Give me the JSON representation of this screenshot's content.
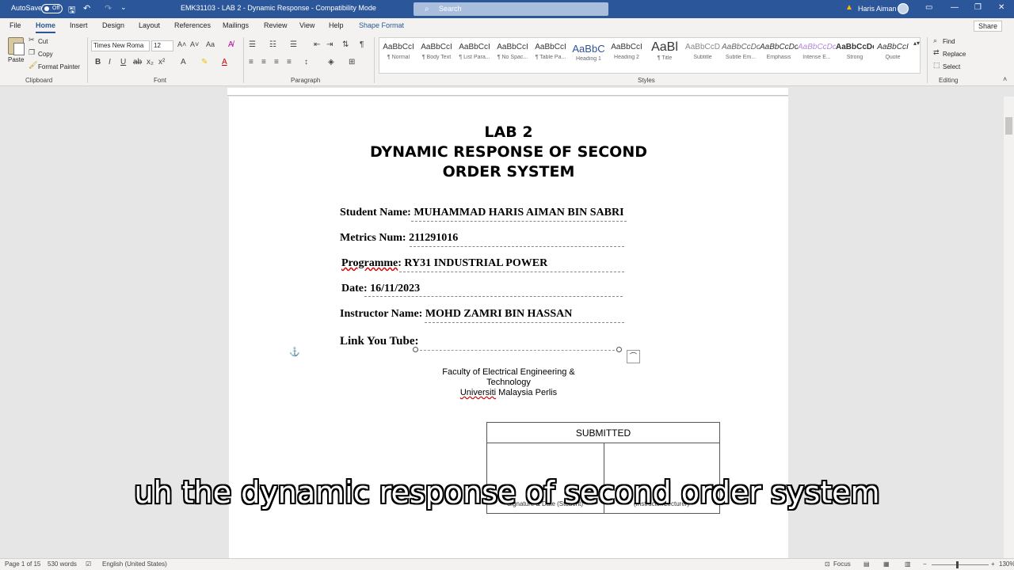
{
  "titlebar": {
    "autosave_label": "AutoSave",
    "autosave_state": "Off",
    "doc_title": "EMK31103 - LAB 2 - Dynamic Response - Compatibility Mode",
    "search_placeholder": "Search",
    "user_name": "Haris Aiman"
  },
  "menu": {
    "tabs": [
      "File",
      "Home",
      "Insert",
      "Design",
      "Layout",
      "References",
      "Mailings",
      "Review",
      "View",
      "Help",
      "Shape Format"
    ],
    "share": "Share"
  },
  "ribbon": {
    "clipboard": {
      "paste": "Paste",
      "cut": "Cut",
      "copy": "Copy",
      "format_painter": "Format Painter",
      "label": "Clipboard"
    },
    "font": {
      "name": "Times New Roma",
      "size": "12",
      "label": "Font"
    },
    "paragraph": {
      "label": "Paragraph"
    },
    "styles": {
      "label": "Styles",
      "items": [
        {
          "preview": "AaBbCcI",
          "name": "¶ Normal"
        },
        {
          "preview": "AaBbCcI",
          "name": "¶ Body Text"
        },
        {
          "preview": "AaBbCcI",
          "name": "¶ List Para..."
        },
        {
          "preview": "AaBbCcI",
          "name": "¶ No Spac..."
        },
        {
          "preview": "AaBbCcI",
          "name": "¶ Table Pa..."
        },
        {
          "preview": "AaBbC",
          "name": "Heading 1"
        },
        {
          "preview": "AaBbCcI",
          "name": "Heading 2"
        },
        {
          "preview": "AaBl",
          "name": "¶ Title"
        },
        {
          "preview": "AaBbCcD",
          "name": "Subtitle"
        },
        {
          "preview": "AaBbCcDc",
          "name": "Subtle Em..."
        },
        {
          "preview": "AaBbCcDc",
          "name": "Emphasis"
        },
        {
          "preview": "AaBbCcDc",
          "name": "Intense E..."
        },
        {
          "preview": "AaBbCcDc",
          "name": "Strong"
        },
        {
          "preview": "AaBbCcI",
          "name": "Quote"
        }
      ]
    },
    "editing": {
      "find": "Find",
      "replace": "Replace",
      "select": "Select",
      "label": "Editing"
    }
  },
  "document": {
    "title_line1": "LAB 2",
    "title_line2": "DYNAMIC RESPONSE OF SECOND",
    "title_line3": "ORDER SYSTEM",
    "student_name": "Student  Name: MUHAMMAD HARIS AIMAN BIN SABRI",
    "metrics_num": "Metrics  Num: 211291016",
    "programme_label": "Programme",
    "programme_value": ": RY31 INDUSTRIAL POWER",
    "date": "Date: 16/11/2023",
    "instructor": "Instructor  Name: MOHD ZAMRI BIN HASSAN",
    "link": "Link You Tube:",
    "faculty_line1": "Faculty of Electrical Engineering &",
    "faculty_line2": "Technology",
    "uni_word": "Universiti",
    "uni_rest": " Malaysia Perlis",
    "table_header": "SUBMITTED",
    "sig_student": "Signature & Date (Student)",
    "sig_instructor": "(Instructor/Lecturer)"
  },
  "caption": "uh the dynamic response of second order system",
  "statusbar": {
    "page": "Page 1 of 15",
    "words": "530 words",
    "language": "English (United States)",
    "focus": "Focus",
    "zoom": "130%"
  }
}
